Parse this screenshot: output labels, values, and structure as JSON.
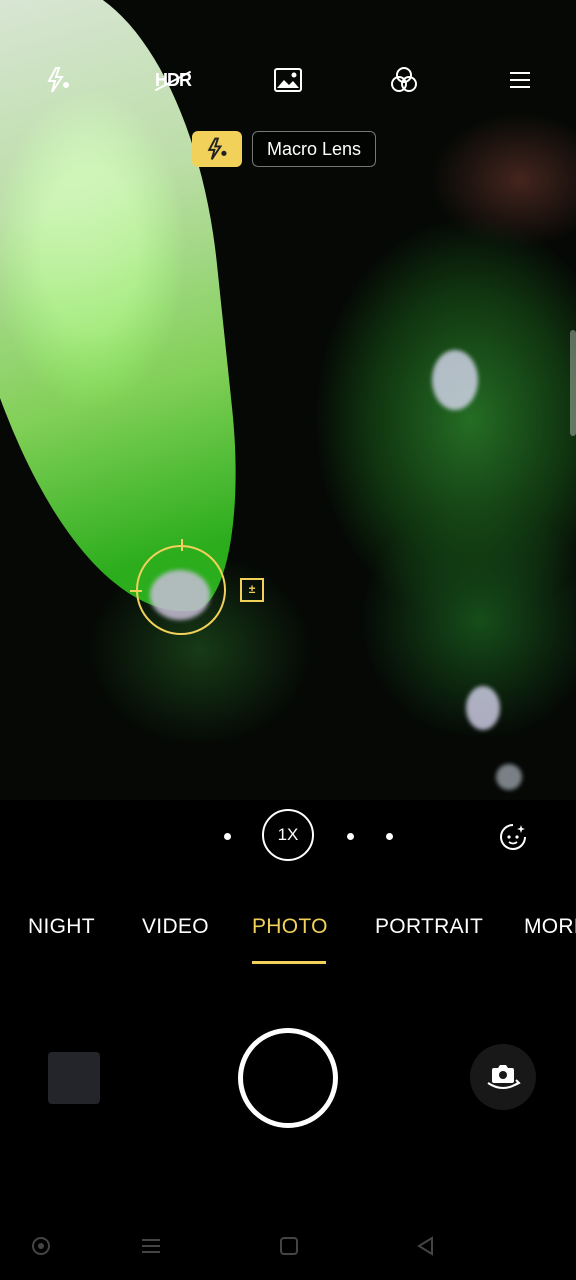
{
  "top_bar": {
    "flash_icon": "flash-auto-icon",
    "hdr_label": "HDR",
    "gallery_icon": "image-icon",
    "filter_icon": "filters-icon",
    "menu_icon": "menu-icon"
  },
  "chips": {
    "flash_icon": "flash-auto-icon",
    "macro_label": "Macro Lens"
  },
  "zoom": {
    "current": "1X"
  },
  "modes": {
    "items": [
      "NIGHT",
      "VIDEO",
      "PHOTO",
      "PORTRAIT",
      "MORE"
    ],
    "active": "PHOTO"
  },
  "colors": {
    "accent": "#f1d15a",
    "background": "#000000"
  }
}
